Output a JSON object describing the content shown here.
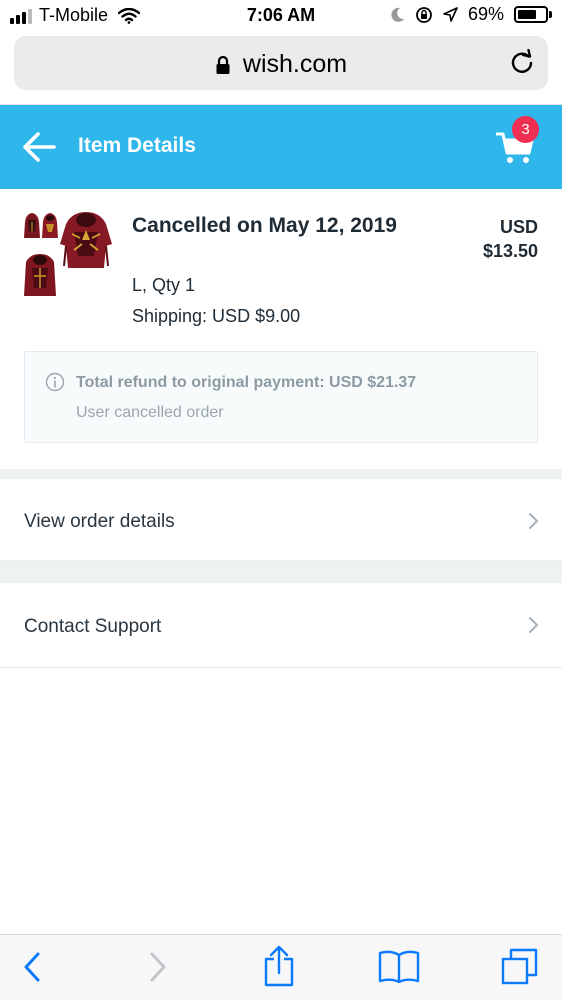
{
  "status_bar": {
    "carrier": "T-Mobile",
    "time": "7:06 AM",
    "battery": "69%",
    "battery_level": 0.69
  },
  "browser": {
    "url": "wish.com"
  },
  "header": {
    "title": "Item Details",
    "cart_count": "3",
    "accent_color": "#2fb7ec",
    "badge_color": "#ef2f52"
  },
  "item": {
    "status": "Cancelled on May 12, 2019",
    "variant": "L, Qty 1",
    "shipping": "Shipping: USD $9.00",
    "currency": "USD",
    "price": "$13.50",
    "refund": "Total refund to original payment: USD $21.37",
    "refund_reason": "User cancelled order"
  },
  "rows": {
    "order_details": "View order details",
    "contact_support": "Contact Support"
  },
  "toolbar": {
    "icons": [
      "back-icon",
      "forward-icon",
      "share-icon",
      "bookmarks-icon",
      "tabs-icon"
    ]
  }
}
